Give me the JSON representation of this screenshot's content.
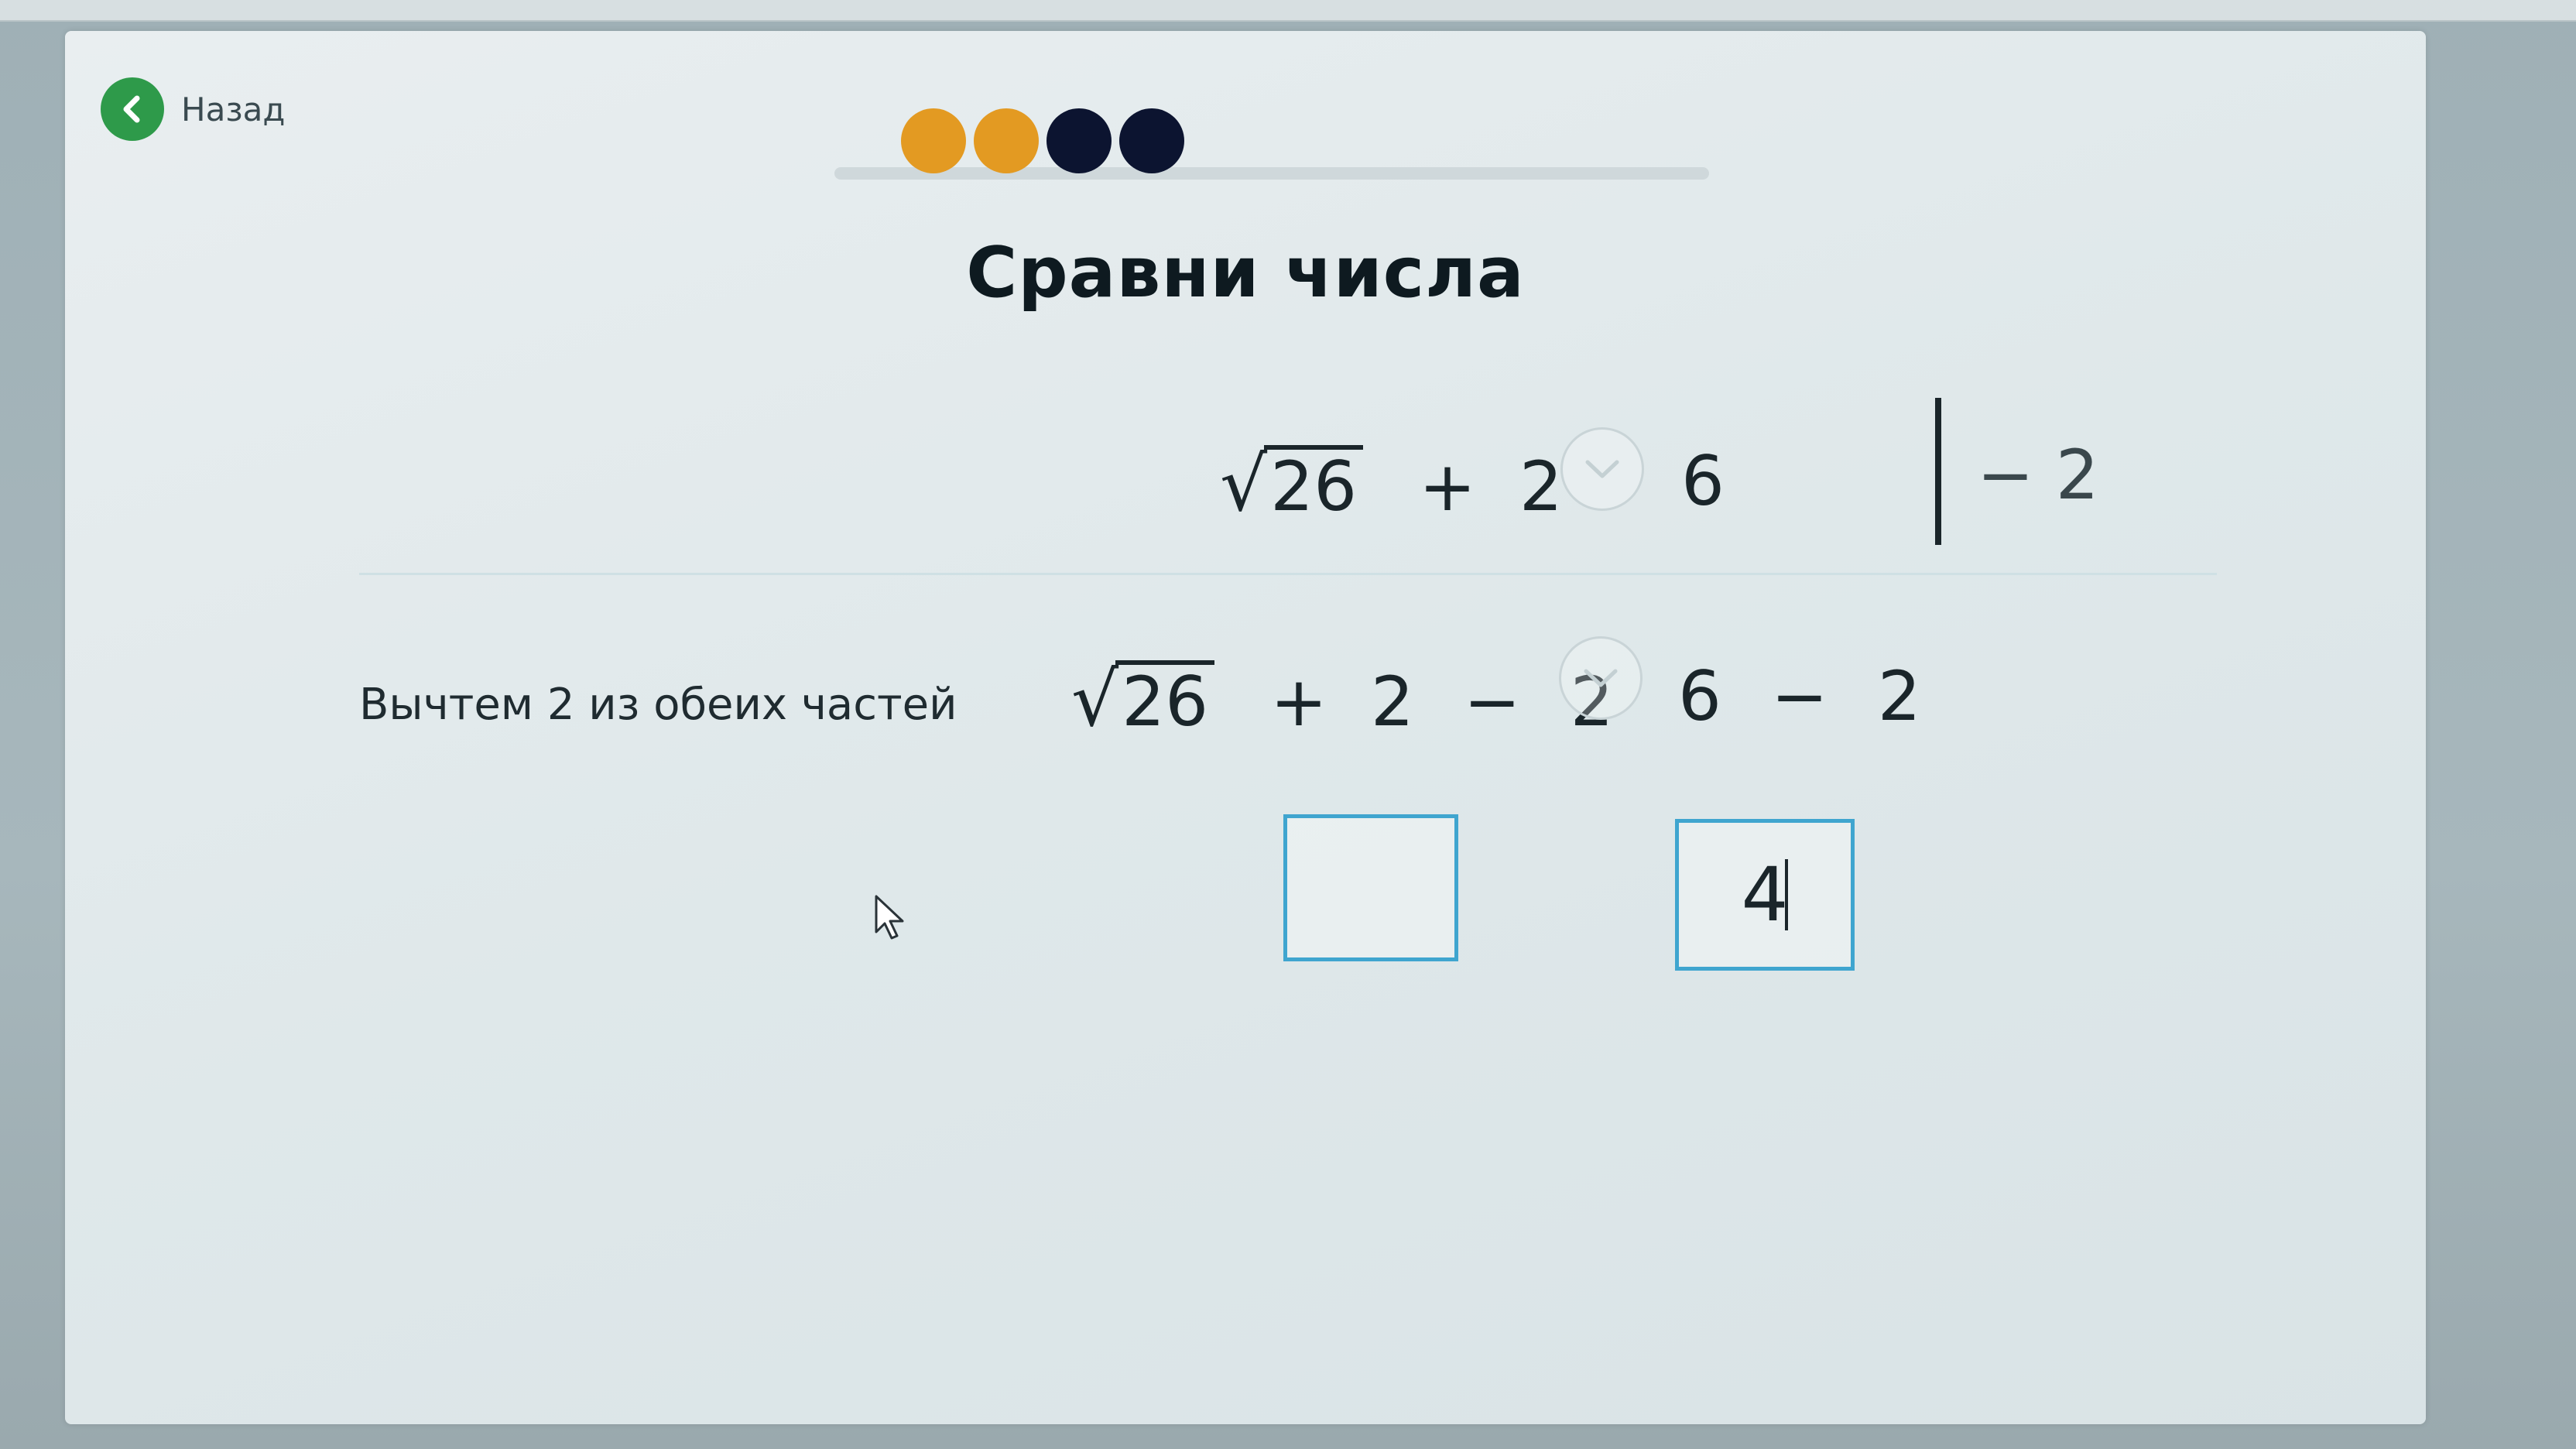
{
  "nav": {
    "back_label": "Назад"
  },
  "progress": {
    "steps_total": 4,
    "steps_done": 2,
    "done_color": "#e39a22",
    "todo_color": "#0c1430"
  },
  "title": "Сравни числа",
  "row1": {
    "radicand": "26",
    "plus": "+",
    "addend": "2",
    "right": "6",
    "operation": "− 2"
  },
  "row2": {
    "label": "Вычтем 2 из обеих частей",
    "radicand": "26",
    "plus": "+",
    "addend": "2",
    "minus": "−",
    "subtrahend": "2",
    "right": "6",
    "right_minus": "−",
    "right_subtrahend": "2"
  },
  "answers": {
    "left_value": "",
    "right_value": "4"
  },
  "colors": {
    "back_button": "#2e9a4a",
    "input_border": "#3fa5cf"
  }
}
